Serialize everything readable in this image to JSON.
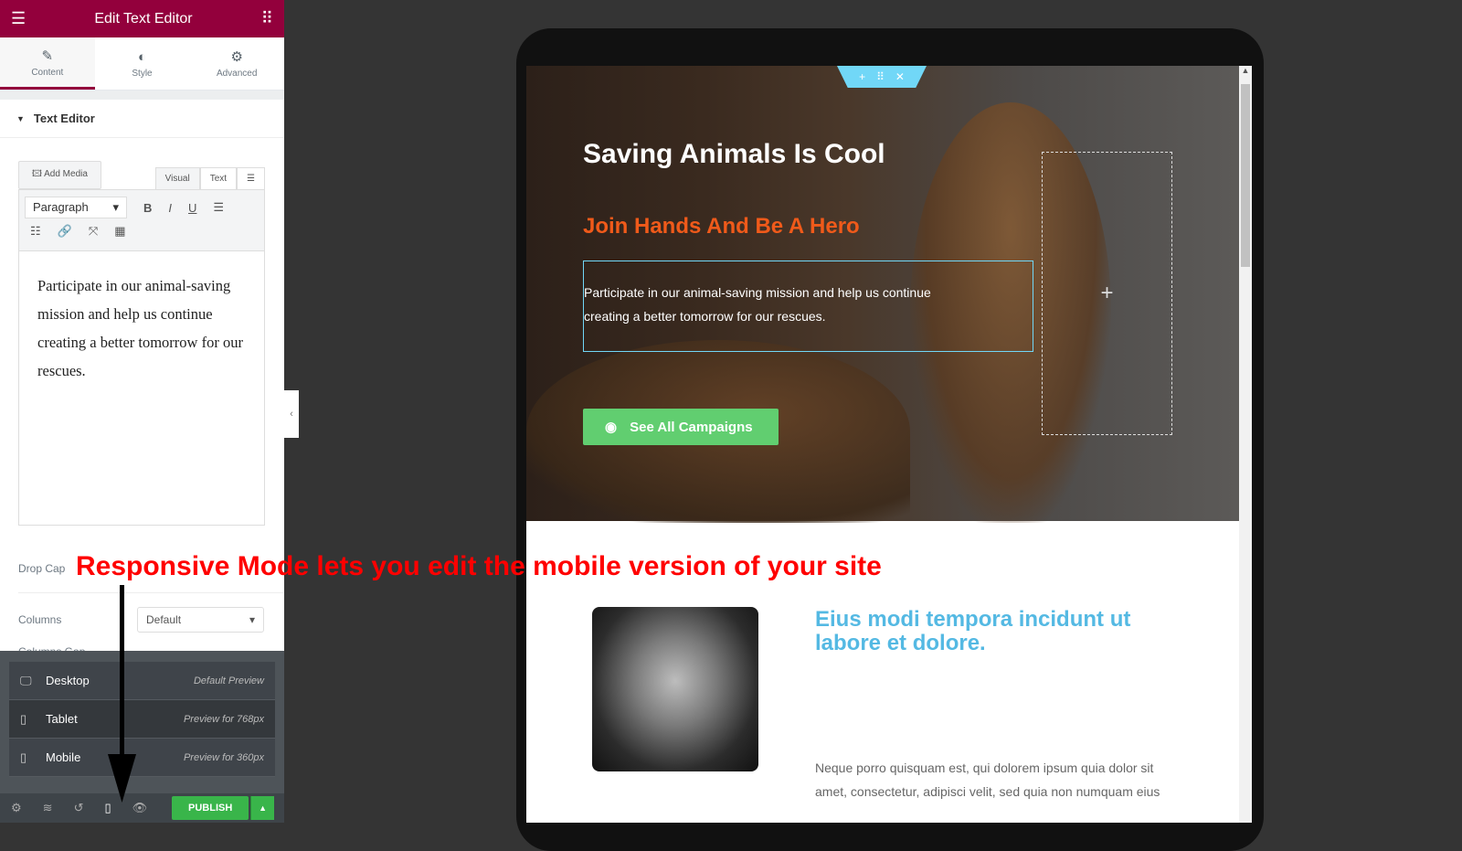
{
  "panel": {
    "title": "Edit Text Editor",
    "tabs": [
      {
        "label": "Content",
        "icon": "pencil-icon"
      },
      {
        "label": "Style",
        "icon": "half-circle-icon"
      },
      {
        "label": "Advanced",
        "icon": "gear-icon"
      }
    ],
    "section": "Text Editor",
    "add_media": "Add Media",
    "mode_tabs": [
      "Visual",
      "Text"
    ],
    "format": "Paragraph",
    "editor_text": "Participate in our animal-saving mission and help us continue creating a better tomorrow for our rescues.",
    "drop_cap": "Drop Cap",
    "columns": "Columns",
    "columns_value": "Default",
    "columns_gap": "Columns Gap",
    "devices": [
      {
        "label": "Desktop",
        "preview": "Default Preview",
        "icon": "desktop-icon"
      },
      {
        "label": "Tablet",
        "preview": "Preview for 768px",
        "icon": "tablet-icon"
      },
      {
        "label": "Mobile",
        "preview": "Preview for 360px",
        "icon": "mobile-icon"
      }
    ],
    "publish": "PUBLISH"
  },
  "preview": {
    "title": "Saving Animals Is Cool",
    "subtitle": "Join Hands And Be A Hero",
    "text": "Participate in our animal-saving mission and help us continue creating a better tomorrow for our rescues.",
    "button": "See All Campaigns",
    "heading": "Eius modi tempora incidunt ut labore et dolore.",
    "paragraph": "Neque porro quisquam est, qui dolorem ipsum quia dolor sit amet, consectetur, adipisci velit, sed quia non numquam eius"
  },
  "annotation": "Responsive Mode lets you edit the mobile version of your site",
  "colors": {
    "brand": "#93003c",
    "publish": "#39b54a",
    "orange": "#f05a1a",
    "blue": "#54b9e3",
    "annotation": "#ff0000"
  }
}
